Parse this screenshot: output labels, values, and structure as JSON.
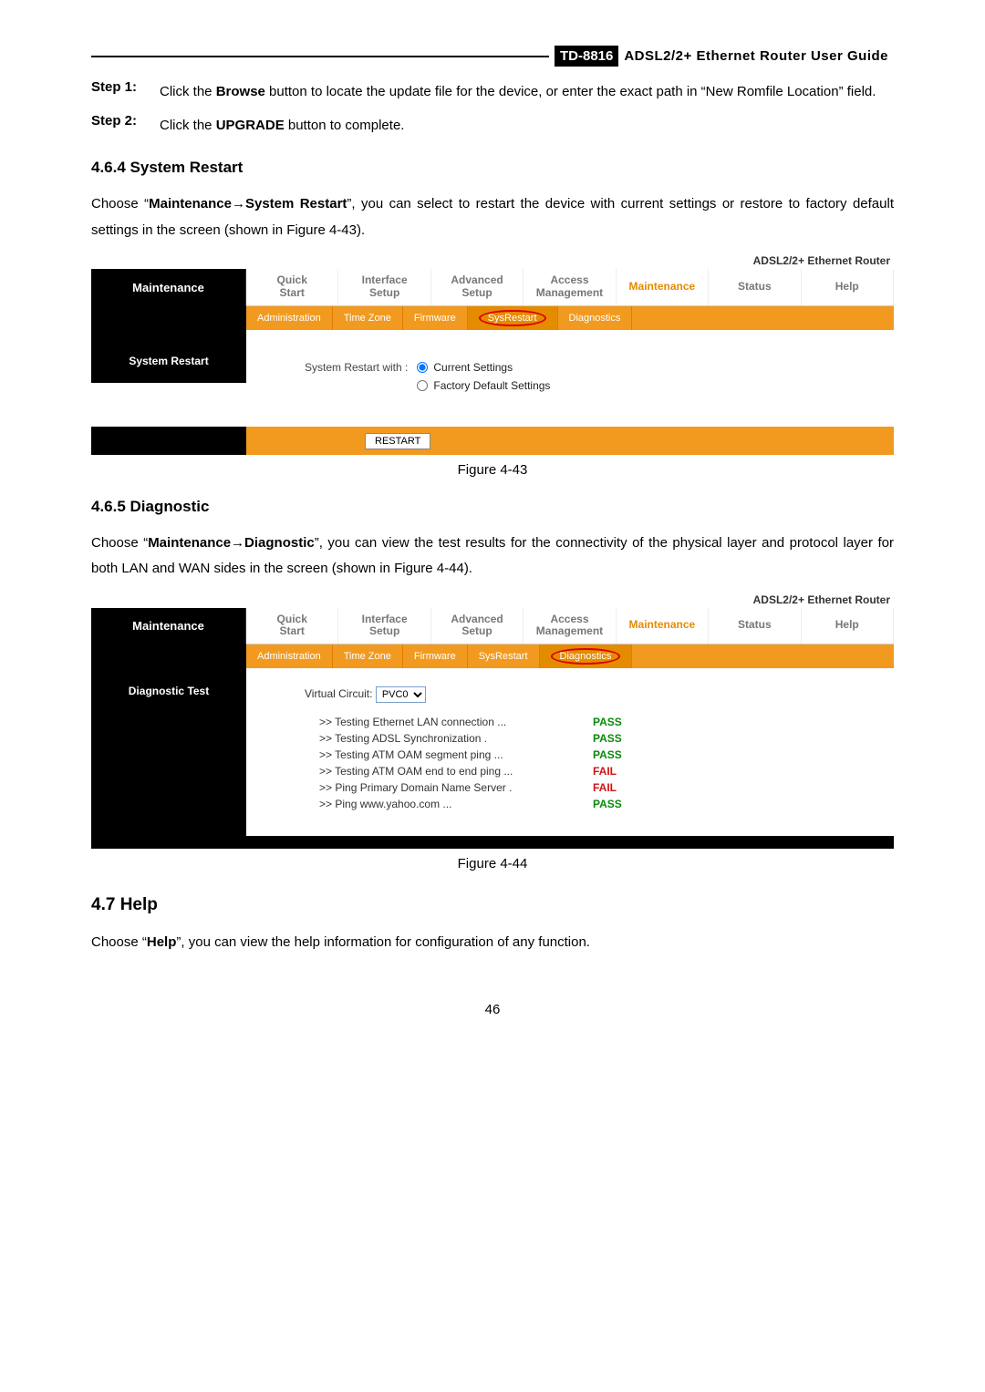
{
  "header": {
    "model": "TD-8816",
    "title": "ADSL2/2+  Ethernet  Router  User  Guide"
  },
  "steps": {
    "step1_label": "Step 1:",
    "step1_text_a": "Click the ",
    "step1_bold": "Browse",
    "step1_text_b": " button to locate the update file for the device, or enter the exact path in “New Romfile Location” field.",
    "step2_label": "Step 2:",
    "step2_text_a": "Click the ",
    "step2_bold": "UPGRADE",
    "step2_text_b": " button to complete."
  },
  "sec464": {
    "heading": "4.6.4  System Restart",
    "para_a": "Choose “",
    "para_bold": "Maintenance→System Restart",
    "para_b": "”, you can select to restart the device with current settings or restore to factory default settings in the screen (shown in Figure 4-43)."
  },
  "fig43": {
    "brand": "ADSL2/2+ Ethernet Router",
    "left": "Maintenance",
    "left_sub": "System Restart",
    "tabs": [
      "Quick\nStart",
      "Interface\nSetup",
      "Advanced\nSetup",
      "Access\nManagement",
      "Maintenance",
      "Status",
      "Help"
    ],
    "active_tab": 4,
    "subtabs": [
      "Administration",
      "Time Zone",
      "Firmware",
      "SysRestart",
      "Diagnostics"
    ],
    "active_sub": 3,
    "restart_label": "System Restart with :",
    "opt1": "Current Settings",
    "opt2": "Factory Default Settings",
    "button": "RESTART",
    "caption": "Figure 4-43"
  },
  "sec465": {
    "heading": "4.6.5  Diagnostic",
    "para_a": "Choose “",
    "para_bold": "Maintenance→Diagnostic",
    "para_b": "”, you can view the test results for the connectivity of the physical layer and protocol layer for both LAN and WAN sides in the screen (shown in Figure 4-44)."
  },
  "fig44": {
    "brand": "ADSL2/2+ Ethernet Router",
    "left": "Maintenance",
    "left_sub": "Diagnostic Test",
    "tabs": [
      "Quick\nStart",
      "Interface\nSetup",
      "Advanced\nSetup",
      "Access\nManagement",
      "Maintenance",
      "Status",
      "Help"
    ],
    "active_tab": 4,
    "subtabs": [
      "Administration",
      "Time Zone",
      "Firmware",
      "SysRestart",
      "Diagnostics"
    ],
    "active_sub": 4,
    "vc_label": "Virtual Circuit:",
    "vc_value": "PVC0",
    "tests": [
      {
        "name": ">> Testing Ethernet LAN connection ...",
        "result": "PASS",
        "cls": "pass"
      },
      {
        "name": ">> Testing ADSL Synchronization .",
        "result": "PASS",
        "cls": "pass"
      },
      {
        "name": ">> Testing ATM OAM segment ping ...",
        "result": "PASS",
        "cls": "pass"
      },
      {
        "name": ">> Testing ATM OAM end to end ping ...",
        "result": "FAIL",
        "cls": "fail"
      },
      {
        "name": ">> Ping Primary Domain Name Server .",
        "result": "FAIL",
        "cls": "fail"
      },
      {
        "name": ">> Ping www.yahoo.com ...",
        "result": "PASS",
        "cls": "pass"
      }
    ],
    "caption": "Figure 4-44"
  },
  "sec47": {
    "heading": "4.7    Help",
    "para_a": "Choose “",
    "para_bold": "Help",
    "para_b": "”, you can view the help information for configuration of any function."
  },
  "pagenum": "46",
  "chart_data": null
}
